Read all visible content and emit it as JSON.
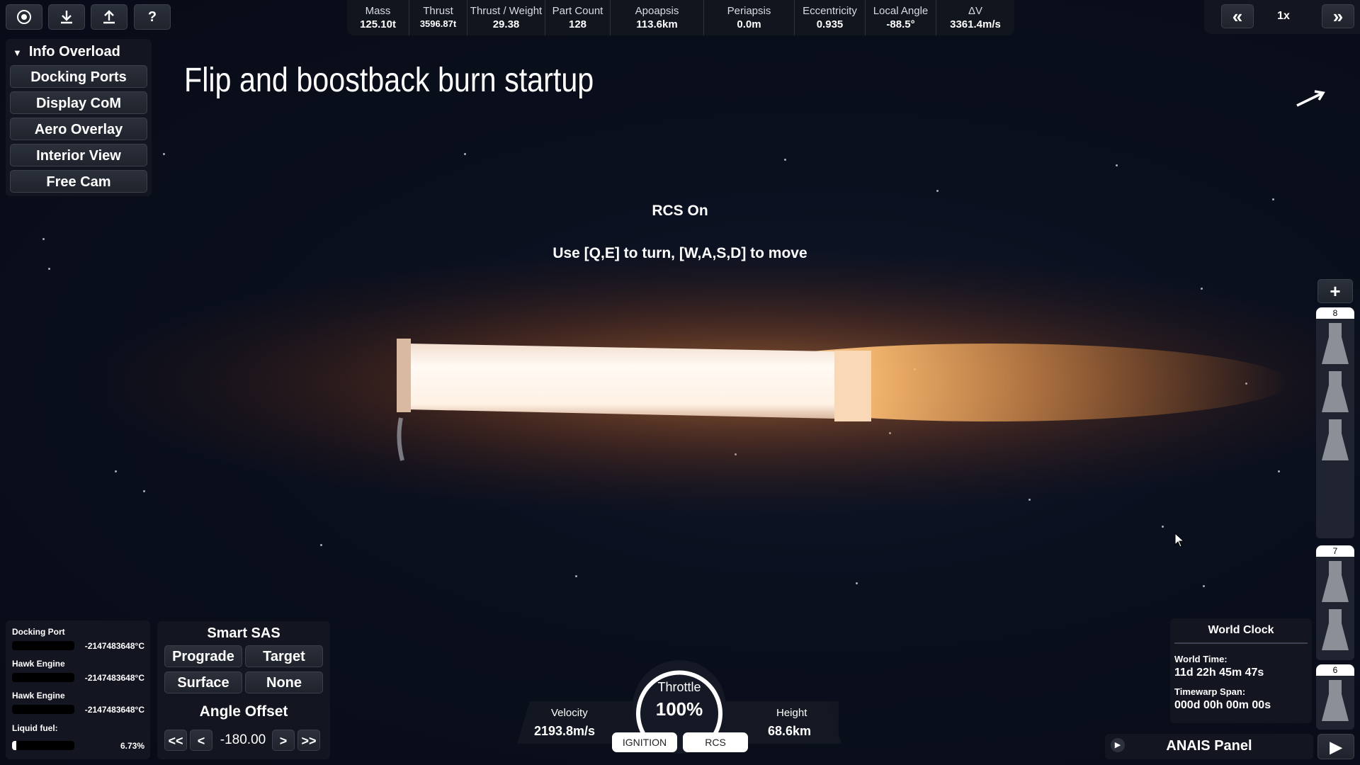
{
  "toolbar": {
    "icons": [
      "globe-icon",
      "download-icon",
      "upload-icon",
      "help-icon"
    ],
    "help_label": "?"
  },
  "stats": [
    {
      "label": "Mass",
      "value": "125.10t"
    },
    {
      "label": "Thrust",
      "value": "3596.87t"
    },
    {
      "label": "Thrust / Weight",
      "value": "29.38"
    },
    {
      "label": "Part Count",
      "value": "128"
    },
    {
      "label": "Apoapsis",
      "value": "113.6km"
    },
    {
      "label": "Periapsis",
      "value": "0.0m"
    },
    {
      "label": "Eccentricity",
      "value": "0.935"
    },
    {
      "label": "Local Angle",
      "value": "-88.5°"
    },
    {
      "label": "ΔV",
      "value": "3361.4m/s"
    }
  ],
  "timewarp": {
    "slower": "«",
    "faster": "»",
    "value": "1x"
  },
  "menu": {
    "title": "Info Overload",
    "items": [
      "Docking Ports",
      "Display CoM",
      "Aero Overlay",
      "Interior View",
      "Free Cam"
    ]
  },
  "caption": "Flip and boostback burn startup",
  "messages": {
    "rcs": "RCS On",
    "hint": "Use [Q,E] to turn, [W,A,S,D] to move"
  },
  "temps": {
    "rows": [
      {
        "name": "Docking Port",
        "value": "-2147483648°C"
      },
      {
        "name": "Hawk Engine",
        "value": "-2147483648°C"
      },
      {
        "name": "Hawk Engine",
        "value": "-2147483648°C"
      }
    ],
    "fuel_label": "Liquid fuel:",
    "fuel_value": "6.73%",
    "fuel_fraction": 0.0673
  },
  "sas": {
    "title": "Smart SAS",
    "buttons": [
      "Prograde",
      "Target",
      "Surface",
      "None"
    ],
    "angle_title": "Angle Offset",
    "angle_value": "-180.00",
    "controls": [
      "<<",
      "<",
      ">",
      ">>"
    ]
  },
  "flight": {
    "velocity_label": "Velocity",
    "velocity": "2193.8m/s",
    "throttle_label": "Throttle",
    "throttle": "100%",
    "throttle_fraction": 1.0,
    "height_label": "Height",
    "height": "68.6km",
    "ignition": "IGNITION",
    "rcs": "RCS"
  },
  "stages": {
    "add": "+",
    "numbers": [
      "8",
      "7",
      "6"
    ]
  },
  "clock": {
    "title": "World Clock",
    "time_label": "World Time:",
    "time": "11d 22h 45m 47s",
    "span_label": "Timewarp Span:",
    "span": "000d 00h 00m 00s"
  },
  "anais": {
    "label": "ANAIS Panel"
  },
  "colors": {
    "panel": "#14182a",
    "flame": "#ff9a3c",
    "hull": "#fff6ee"
  }
}
